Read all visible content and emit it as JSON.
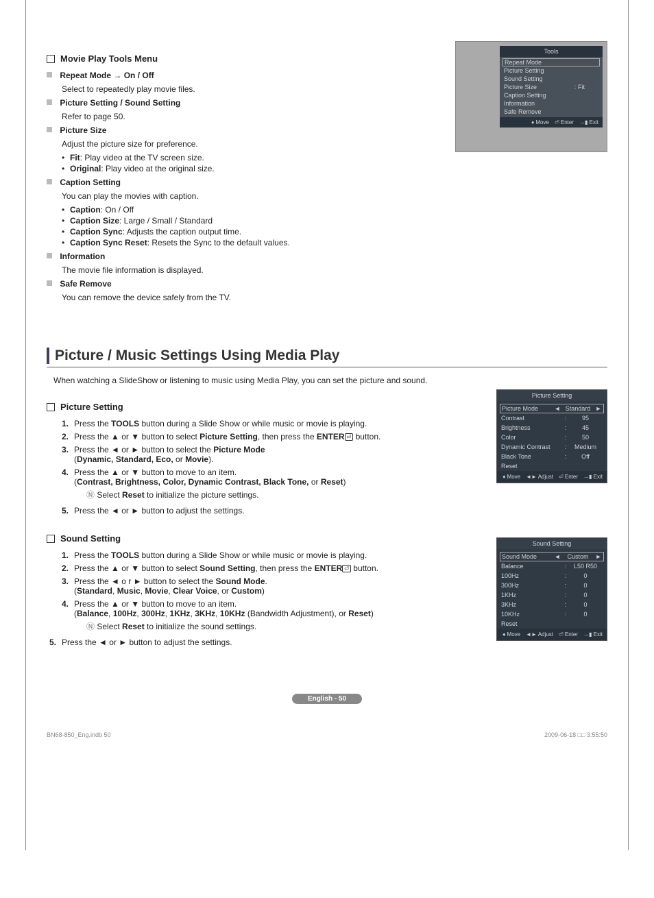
{
  "glyphs": {
    "up": "▲",
    "down": "▼",
    "left": "◄",
    "right": "►",
    "updown": "♦",
    "leftright": "◄►",
    "enter": "⏎",
    "exit": "→▮"
  },
  "section1": {
    "heading": "Movie Play Tools Menu",
    "items": [
      {
        "key": "repeat",
        "title": "Repeat Mode → On / Off",
        "desc": "Select to repeatedly play movie files."
      },
      {
        "key": "pic_sound",
        "title": "Picture Setting / Sound Setting",
        "desc": "Refer to page 50."
      },
      {
        "key": "picsize",
        "title": "Picture Size",
        "desc": "Adjust the picture size for preference.",
        "bullets": [
          {
            "b": "Fit",
            "t": ": Play video at the TV screen size."
          },
          {
            "b": "Original",
            "t": ": Play video at the original size."
          }
        ]
      },
      {
        "key": "caption",
        "title": "Caption Setting",
        "desc": "You can play the movies with caption.",
        "bullets": [
          {
            "b": "Caption",
            "t": ": On / Off"
          },
          {
            "b": "Caption Size",
            "t": ": Large / Small / Standard"
          },
          {
            "b": "Caption Sync",
            "t": ": Adjusts the caption output time."
          },
          {
            "b": "Caption Sync Reset",
            "t": ": Resets the Sync to the default values."
          }
        ]
      },
      {
        "key": "info",
        "title": "Information",
        "desc": "The movie file information is displayed."
      },
      {
        "key": "safe",
        "title": "Safe Remove",
        "desc": "You can remove the device safely from the TV."
      }
    ]
  },
  "tools_osd": {
    "title": "Tools",
    "rows": [
      {
        "label": "Repeat Mode",
        "sel": true
      },
      {
        "label": "Picture Setting"
      },
      {
        "label": "Sound Setting"
      },
      {
        "label": "Picture Size",
        "colon": ":",
        "val": "Fit"
      },
      {
        "label": "Caption Setting"
      },
      {
        "label": "Information"
      },
      {
        "label": "Safe Remove"
      }
    ],
    "footer": {
      "move": "Move",
      "enter": "Enter",
      "exit": "Exit"
    }
  },
  "major_heading": "Picture / Music Settings Using Media Play",
  "intro": "When watching a SlideShow or listening to music using Media Play, you can set the picture and sound.",
  "picture_setting": {
    "heading": "Picture Setting",
    "steps": [
      {
        "n": "1.",
        "pre": "Press the ",
        "b1": "TOOLS",
        "post": " button during a Slide Show or while music or movie is playing."
      },
      {
        "n": "2.",
        "raw": "Press the ▲ or ▼ button to select ",
        "b": "Picture Setting",
        "mid": ", then press the ",
        "b2": "ENTER",
        "icon": true,
        "end": " button."
      },
      {
        "n": "3.",
        "raw": "Press the ◄ or ► button to select the ",
        "b": "Picture Mode",
        "detail": "(Dynamic, Standard, Eco, ",
        "or": "or ",
        "b3": "Movie",
        "close": ")."
      },
      {
        "n": "4.",
        "raw": "Press the ▲ or ▼ button to move to an item.",
        "detail2": "(Contrast, Brightness, Color, Dynamic Contrast, Black Tone, ",
        "or2": "or ",
        "b4": "Reset",
        "close2": ")",
        "note": "Select Reset to initialize the picture settings."
      },
      {
        "n": "5.",
        "raw": "Press the ◄ or ► button to adjust the settings."
      }
    ]
  },
  "picture_osd": {
    "title": "Picture Setting",
    "rows": [
      {
        "label": "Picture Mode",
        "val": "Standard",
        "sel": true,
        "arrows": true
      },
      {
        "label": "Contrast",
        "colon": ":",
        "val": "95"
      },
      {
        "label": "Brightness",
        "colon": ":",
        "val": "45"
      },
      {
        "label": "Color",
        "colon": ":",
        "val": "50"
      },
      {
        "label": "Dynamic Contrast",
        "colon": ":",
        "val": "Medium"
      },
      {
        "label": "Black Tone",
        "colon": ":",
        "val": "Off"
      },
      {
        "label": "Reset"
      }
    ],
    "footer": {
      "move": "Move",
      "adjust": "Adjust",
      "enter": "Enter",
      "exit": "Exit"
    }
  },
  "sound_setting": {
    "heading": "Sound Setting",
    "steps": [
      {
        "n": "1.",
        "pre": "Press the ",
        "b1": "TOOLS",
        "post": " button during a Slide Show or while music or movie is playing."
      },
      {
        "n": "2.",
        "raw": "Press the ▲ or ▼ button to select ",
        "b": "Sound Setting",
        "mid": ", then press the ",
        "b2": "ENTER",
        "icon": true,
        "end": " button."
      },
      {
        "n": "3.",
        "raw": "Press the ◄ o r ► button to select the ",
        "b": "Sound Mode",
        "end2": ".",
        "detail": "(Standard, Music, Movie, Clear Voice, ",
        "or": "or ",
        "b3": "Custom",
        "close": ")"
      },
      {
        "n": "4.",
        "raw": "Press the ▲ or ▼ button to move to an item.",
        "detail2": "(Balance, 100Hz, 300Hz, 1KHz, 3KHz, 10KHz ",
        "mid2": "(Bandwidth Adjustment), or ",
        "b4": "Reset",
        "close2": ")",
        "note": "Select Reset to initialize the sound settings."
      },
      {
        "n": "5.",
        "raw5": "Press the ◄ or ► button to adjust the settings."
      }
    ]
  },
  "sound_osd": {
    "title": "Sound Setting",
    "rows": [
      {
        "label": "Sound Mode",
        "val": "Custom",
        "sel": true,
        "arrows": true
      },
      {
        "label": "Balance",
        "colon": ":",
        "val": "L50 R50"
      },
      {
        "label": "100Hz",
        "colon": ":",
        "val": "0"
      },
      {
        "label": "300Hz",
        "colon": ":",
        "val": "0"
      },
      {
        "label": "1KHz",
        "colon": ":",
        "val": "0"
      },
      {
        "label": "3KHz",
        "colon": ":",
        "val": "0"
      },
      {
        "label": "10KHz",
        "colon": ":",
        "val": "0"
      },
      {
        "label": "Reset"
      }
    ],
    "footer": {
      "move": "Move",
      "adjust": "Adjust",
      "enter": "Enter",
      "exit": "Exit"
    }
  },
  "footer_badge": "English - 50",
  "print_foot": {
    "left": "BN68-850_Eng.indb   50",
    "right": "2009-06-18   □□ 3:55:50"
  }
}
